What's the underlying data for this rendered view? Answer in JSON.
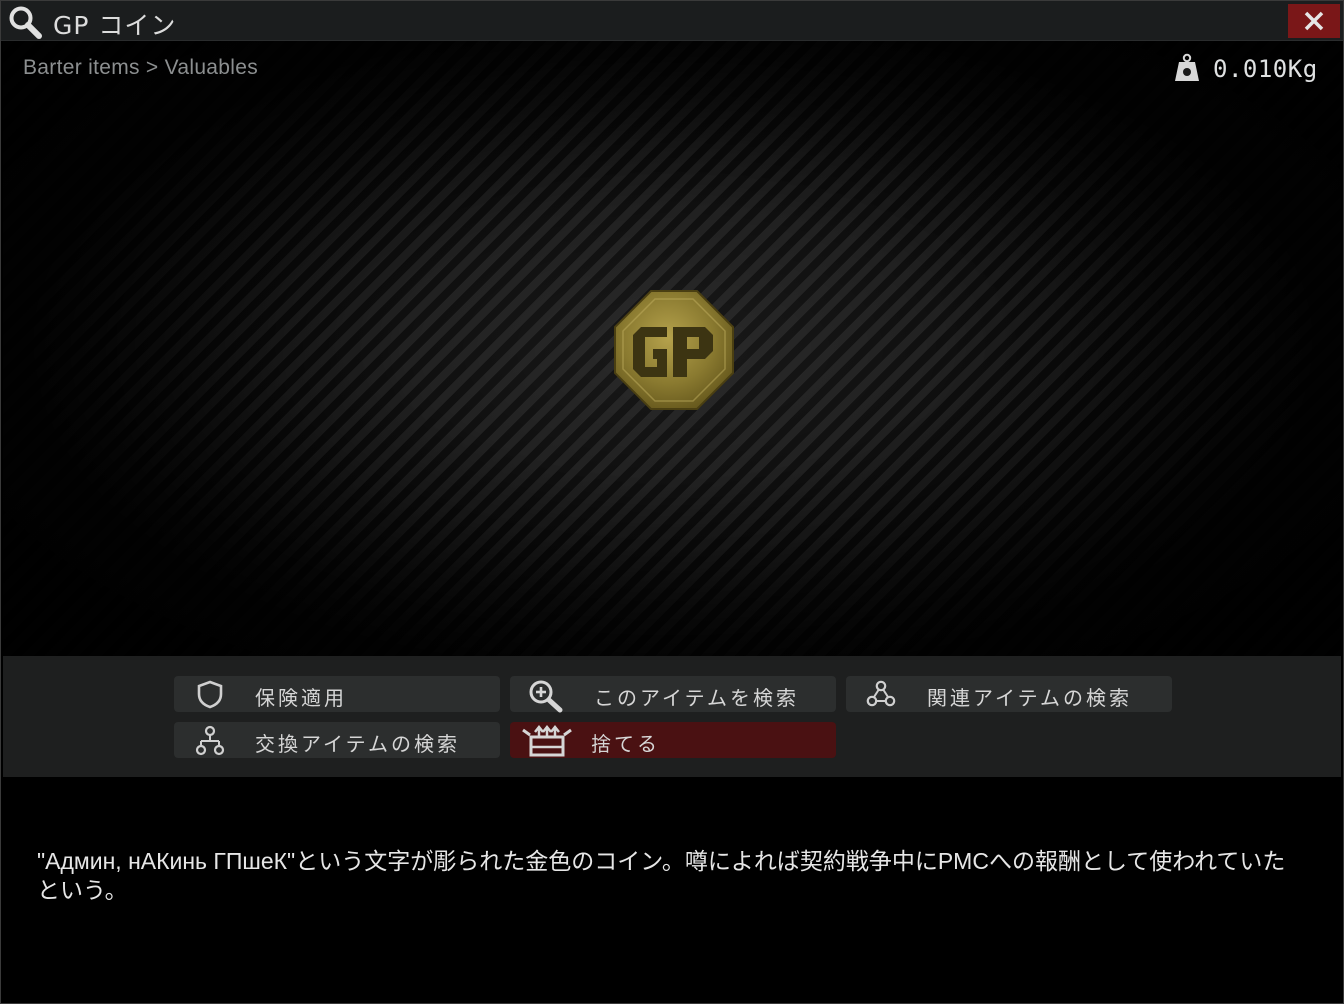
{
  "window": {
    "title": "GP コイン",
    "close_label": "×"
  },
  "preview": {
    "breadcrumb": "Barter items > Valuables",
    "weight": "0.010Kg",
    "item_image": "gp-coin-icon"
  },
  "actions": {
    "insure": "保険適用",
    "search_item": "このアイテムを検索",
    "search_related": "関連アイテムの検索",
    "search_barter": "交換アイテムの検索",
    "discard": "捨てる"
  },
  "description": "\"Админ, нАКинь ГПшеК\"という文字が彫られた金色のコイン。噂によれば契約戦争中にPMCへの報酬として使われていたという。",
  "colors": {
    "titlebar": "#1b1d1e",
    "close_button": "#7a1718",
    "action_panel": "#1e1f1f",
    "action_button": "#2c2e2e",
    "discard_button": "#4a1112",
    "coin_gold": "#8c7a2c"
  }
}
